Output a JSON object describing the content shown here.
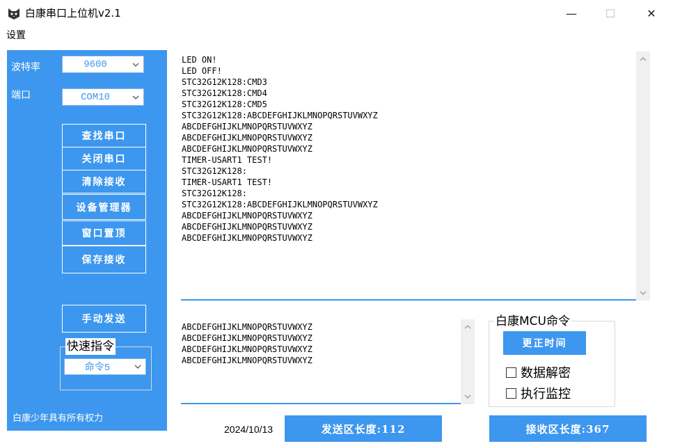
{
  "window": {
    "title": "白康串口上位机v2.1",
    "min_glyph": "—",
    "max_glyph": "☐",
    "close_glyph": "✕"
  },
  "menu": {
    "settings": "设置"
  },
  "left": {
    "baud_label": "波特率",
    "baud_value": "9600",
    "port_label": "端口",
    "port_value": "COM10",
    "buttons": [
      "查找串口",
      "关闭串口",
      "清除接收",
      "设备管理器",
      "窗口置顶",
      "保存接收"
    ],
    "manual_send": "手动发送",
    "quick_title": "快速指令",
    "quick_value": "命令5",
    "copyright": "白康少年具有所有权力"
  },
  "receive": {
    "text": "LED ON!\nLED OFF!\nSTC32G12K128:CMD3\nSTC32G12K128:CMD4\nSTC32G12K128:CMD5\nSTC32G12K128:ABCDEFGHIJKLMNOPQRSTUVWXYZ\nABCDEFGHIJKLMNOPQRSTUVWXYZ\nABCDEFGHIJKLMNOPQRSTUVWXYZ\nABCDEFGHIJKLMNOPQRSTUVWXYZ\nTIMER-USART1 TEST!\nSTC32G12K128:\nTIMER-USART1 TEST!\nSTC32G12K128:\nSTC32G12K128:ABCDEFGHIJKLMNOPQRSTUVWXYZ\nABCDEFGHIJKLMNOPQRSTUVWXYZ\nABCDEFGHIJKLMNOPQRSTUVWXYZ\nABCDEFGHIJKLMNOPQRSTUVWXYZ"
  },
  "send": {
    "text": "ABCDEFGHIJKLMNOPQRSTUVWXYZ\nABCDEFGHIJKLMNOPQRSTUVWXYZ\nABCDEFGHIJKLMNOPQRSTUVWXYZ\nABCDEFGHIJKLMNOPQRSTUVWXYZ"
  },
  "mcu": {
    "title": "白康MCU命令",
    "sync_time": "更正时间",
    "decrypt": "数据解密",
    "monitor": "执行监控"
  },
  "status": {
    "date": "2024/10/13",
    "send_len": "发送区长度:112",
    "recv_len": "接收区长度:367"
  },
  "colors": {
    "accent": "#3d97ee"
  },
  "icons": {
    "app": "cat-icon",
    "dropdown": "chevron-down-icon",
    "scroll_up": "chevron-up-icon",
    "scroll_down": "chevron-down-icon"
  }
}
